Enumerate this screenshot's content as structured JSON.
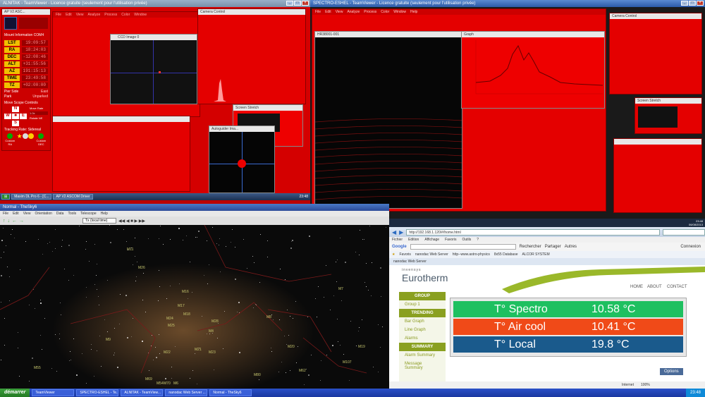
{
  "left_session": {
    "title": "ALNITAK - TeamViewer - Licence gratuite (seulement pour l'utilisation privée)",
    "mount_panel": {
      "title": "AP V2 ASC...",
      "section_mount": "Mount Information COM4",
      "rows": [
        {
          "label": "LST",
          "value": "19:09:57"
        },
        {
          "label": "RA",
          "value": "18:24:03"
        },
        {
          "label": "DEC",
          "value": "-12:08:46"
        },
        {
          "label": "ALT",
          "value": "+31:55:56"
        },
        {
          "label": "AZ",
          "value": "191:15:13"
        },
        {
          "label": "TIME",
          "value": "23:49:58"
        },
        {
          "label": "TZ",
          "value": "+02:00:00"
        }
      ],
      "pier_side_label": "Pier Side",
      "pier_side_value": "East",
      "park_label": "Park",
      "park_value": "Unparked",
      "section_move": "Move Scope Controls",
      "move_rate_label": "Move Rate",
      "move_rate_value": "1.0x",
      "rotate_label": "Rotate NE",
      "section_tracking": "Tracking Rate: Sidereal",
      "track_buttons": [
        "Custom RA",
        "Star",
        "Lunar",
        "Solar",
        "Custom DEC"
      ]
    },
    "ccd_window_title": "CCD Image 0",
    "camera_control_title": "Camera Control",
    "screen_stretch_title": "Screen Stretch",
    "autoguider_title": "Autoguider Ima...",
    "taskbar_items": [
      "Maxim DL Pro 6 - [C...",
      "AP V2 ASCOM Driver"
    ],
    "clock": "23:48"
  },
  "right_session": {
    "title": "SPECTRO-ESHEL - TeamViewer - Licence gratuite (seulement pour l'utilisation privée)",
    "image_window_title": "HR38001-001",
    "graph_window_title": "Graph",
    "camera_control_title": "Camera Control",
    "screen_stretch_title": "Screen Stretch",
    "clock": "23:48",
    "date": "06/08/2013"
  },
  "sky_window": {
    "title": "Normal - TheSky6",
    "menu": [
      "File",
      "Edit",
      "View",
      "Orientation",
      "Data",
      "Tools",
      "Telescope",
      "Help"
    ],
    "time_field": "Tx (local time)",
    "objects": [
      "M11",
      "M26",
      "M16",
      "M17",
      "M18",
      "M24",
      "M25",
      "M28",
      "M22",
      "M8",
      "M20",
      "M21",
      "M23",
      "M55",
      "M54",
      "M69",
      "M70",
      "M6",
      "M7",
      "M19",
      "M62",
      "M107",
      "M80",
      "M4",
      "M9"
    ]
  },
  "browser": {
    "url": "http://192.168.1.120/#/home.html",
    "toolbar_search": "Google",
    "search_btn": "Rechercher",
    "share_btn": "Partager",
    "more_btn": "Autres",
    "login_btn": "Connexion",
    "menu": [
      "Fichier",
      "Edition",
      "Affichage",
      "Favoris",
      "Outils",
      "?"
    ],
    "favorites": [
      "Favoris",
      "nanodac Web Server",
      "http--www.astro-physics",
      "8x55 Database",
      "ALCOR SYSTEM"
    ],
    "tab_title": "nanodac Web Server",
    "status_internet": "Internet",
    "zoom": "100%"
  },
  "eurotherm": {
    "brand_small": "invensys",
    "brand": "Eurotherm",
    "nav": [
      "HOME",
      "ABOUT",
      "CONTACT"
    ],
    "sidebar": {
      "group_head": "GROUP",
      "group_items": [
        "Group 1"
      ],
      "trending_head": "TRENDING",
      "trending_items": [
        "Bar Graph",
        "Line Graph",
        "Alarms"
      ],
      "summary_head": "SUMMARY",
      "summary_items": [
        "Alarm Summary",
        "Message Summary"
      ]
    },
    "sensors": [
      {
        "name": "T° Spectro",
        "value": "10.58 °C",
        "color": "#1ec060"
      },
      {
        "name": "T° Air cool",
        "value": "10.41 °C",
        "color": "#f04a18"
      },
      {
        "name": "T° Local",
        "value": "19.8 °C",
        "color": "#1a5a8c"
      }
    ],
    "options_btn": "Options"
  },
  "main_taskbar": {
    "start": "démarrer",
    "items": [
      "TeamViewer",
      "SPECTRO-ESHEL - Te...",
      "ALNITAK - TeamView...",
      "nanodac Web Server ...",
      "Normal - TheSky6"
    ],
    "clock": "23:48"
  }
}
